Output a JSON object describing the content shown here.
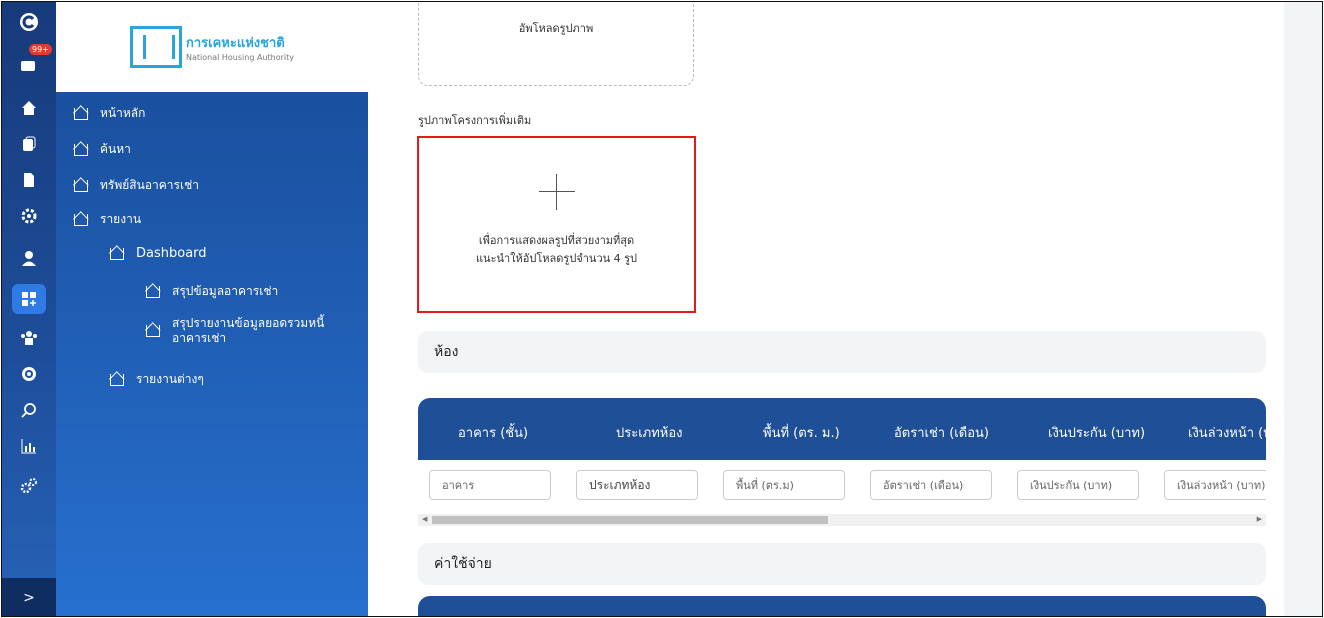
{
  "rail": {
    "badge": "99+",
    "toggle_label": ">"
  },
  "logo": {
    "thai": "การเคหะแห่งชาติ",
    "english": "National Housing Authority"
  },
  "nav": {
    "home": "หน้าหลัก",
    "search": "ค้นหา",
    "assets": "ทรัพย์สินอาคารเช่า",
    "reports": "รายงาน",
    "dashboard": "Dashboard",
    "rental_summary": "สรุปข้อมูลอาคารเช่า",
    "debt_summary_line1": "สรุปรายงานข้อมูลยอดรวมหนี้",
    "debt_summary_line2": "อาคารเช่า",
    "misc_reports": "รายงานต่างๆ"
  },
  "main": {
    "upload_label": "อัพโหลดรูปภาพ",
    "extra_photos_label": "รูปภาพโครงการเพิ่มเติม",
    "add_hint_line1": "เพื่อการแสดงผลรูปที่สวยงามที่สุด",
    "add_hint_line2": "แนะนำให้อัปโหลดรูปจำนวน 4 รูป",
    "rooms_section": "ห้อง",
    "expenses_section": "ค่าใช้จ่าย"
  },
  "table": {
    "headers": [
      "อาคาร (ชั้น)",
      "ประเภทห้อง",
      "พื้นที่ (ตร. ม.)",
      "อัตราเช่า (เดือน)",
      "เงินประกัน (บาท)",
      "เงินล่วงหน้า (บาท)"
    ],
    "filter_placeholders": [
      "อาคาร",
      "ประเภทห้อง",
      "พื้นที่ (ตร.ม)",
      "อัตราเช่า (เดือน)",
      "เงินประกัน (บาท)",
      "เงินล่วงหน้า (บาท)"
    ]
  }
}
